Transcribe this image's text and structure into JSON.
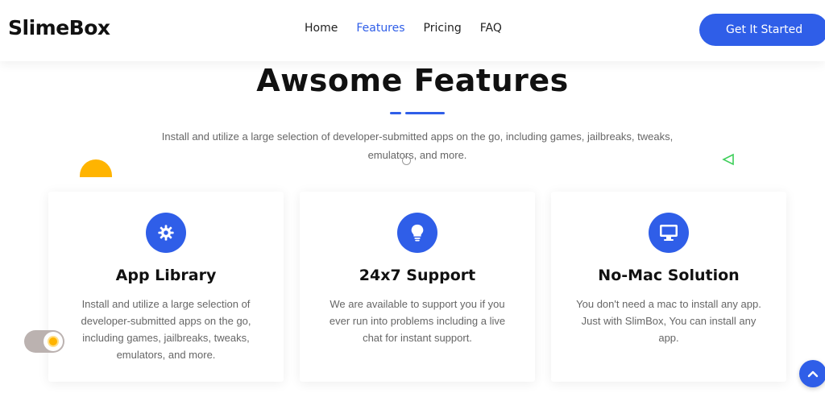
{
  "brand": {
    "name": "SlimeBox"
  },
  "nav": {
    "items": [
      {
        "label": "Home",
        "active": false
      },
      {
        "label": "Features",
        "active": true
      },
      {
        "label": "Pricing",
        "active": false
      },
      {
        "label": "FAQ",
        "active": false
      }
    ],
    "cta_label": "Get It Started"
  },
  "section": {
    "title": "Awsome Features",
    "intro": "Install and utilize a large selection of developer-submitted apps on the go, including games, jailbreaks, tweaks, emulators, and more."
  },
  "cards": [
    {
      "icon": "gear-icon",
      "title": "App Library",
      "desc": "Install and utilize a large selection of developer-submitted apps on the go, including games, jailbreaks, tweaks, emulators, and more."
    },
    {
      "icon": "lightbulb-icon",
      "title": "24x7 Support",
      "desc": "We are available to support you if you ever run into problems including a live chat for instant support."
    },
    {
      "icon": "monitor-icon",
      "title": "No-Mac Solution",
      "desc": "You don't need a mac to install any app. Just with SlimBox, You can install any app."
    }
  ],
  "colors": {
    "accent": "#2f5ee8",
    "yellow": "#ffb400",
    "green": "#3ecf5a"
  },
  "widgets": {
    "theme_toggle_icon": "sun-icon",
    "scroll_top_icon": "chevron-up-icon"
  }
}
